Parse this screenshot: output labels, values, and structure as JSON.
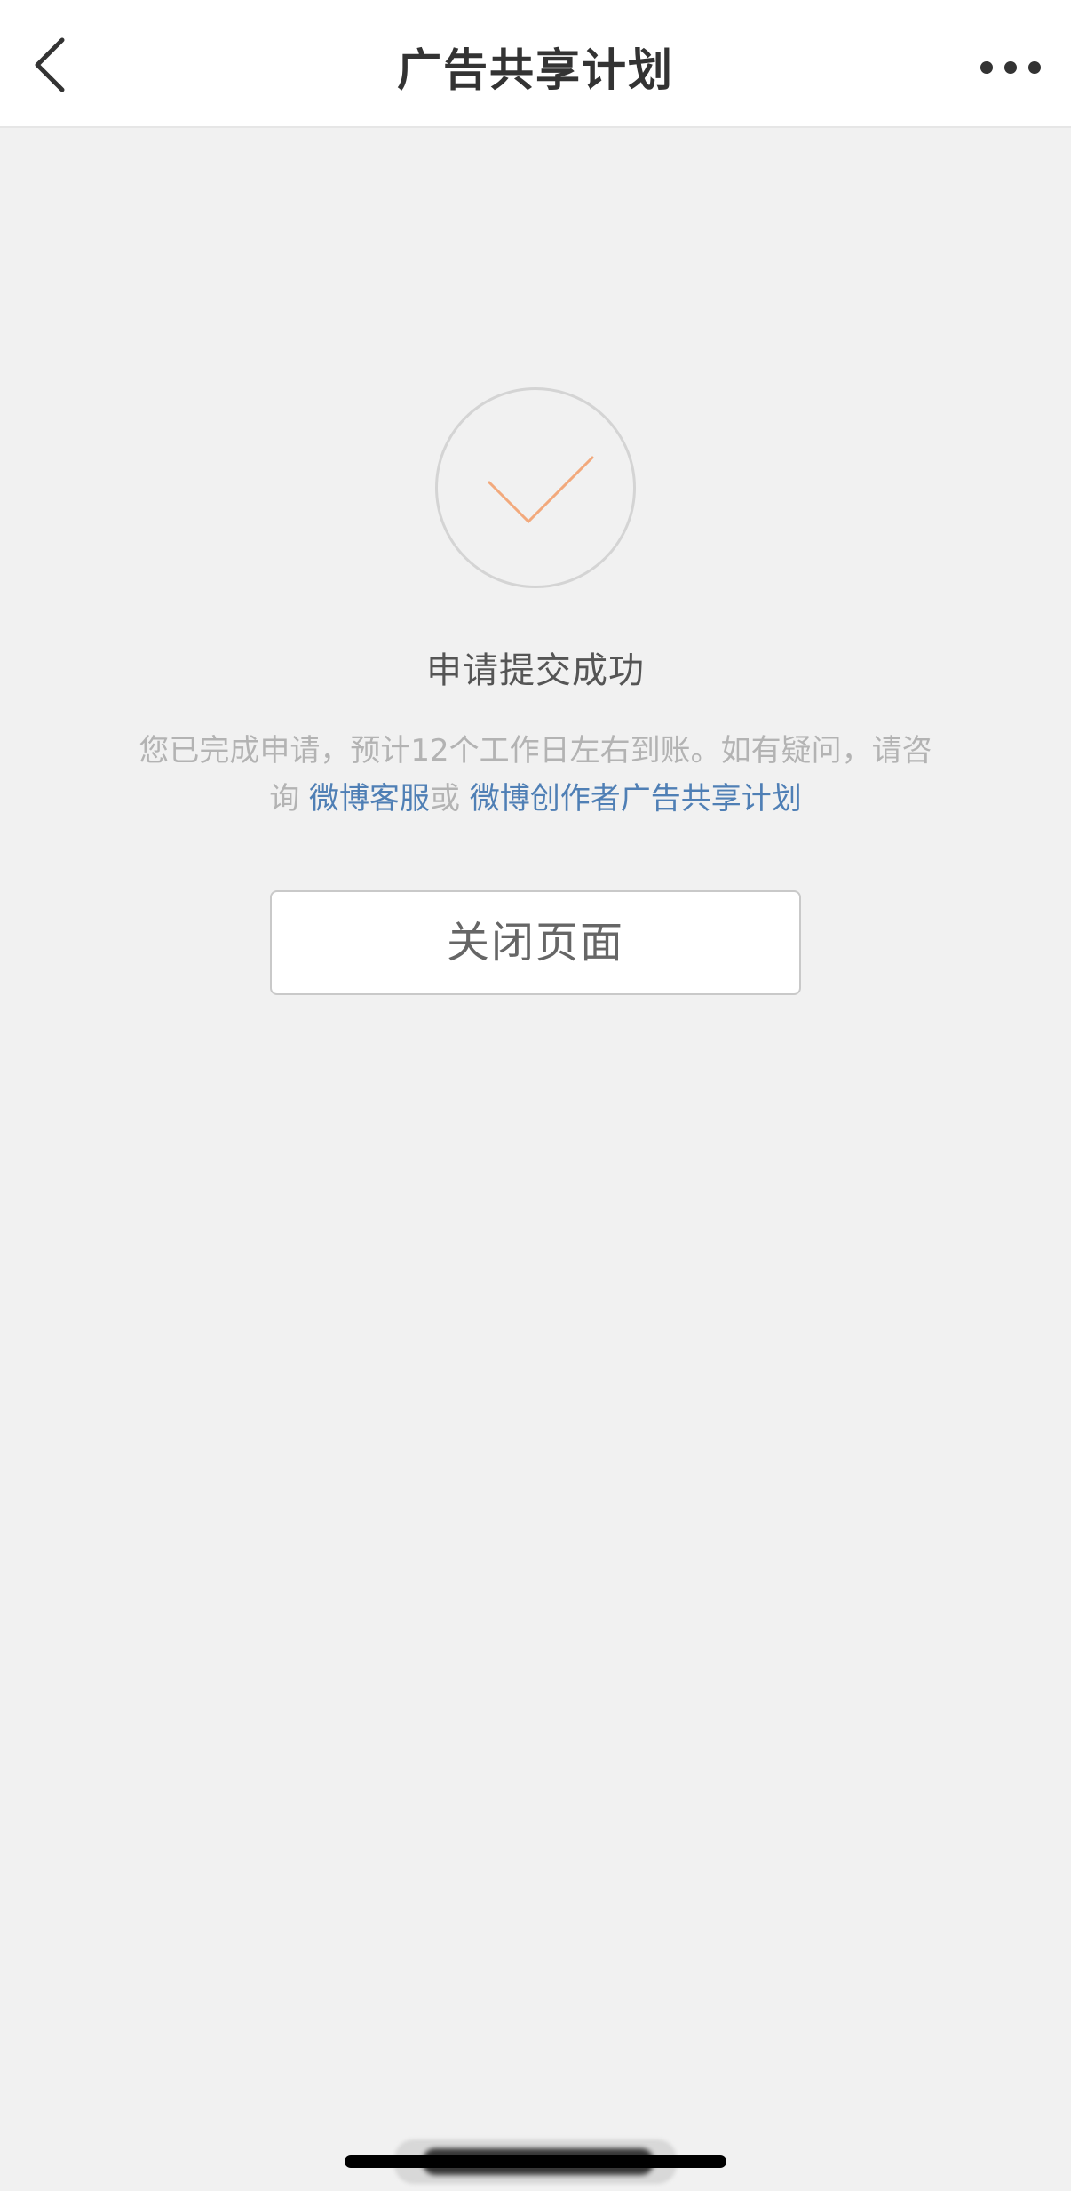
{
  "nav": {
    "title": "广告共享计划",
    "back_icon": "chevron-left-icon",
    "more_icon": "more-horizontal-icon"
  },
  "success": {
    "icon": "check-icon",
    "icon_color": "#f2a97c",
    "title": "申请提交成功"
  },
  "message": {
    "text_before": "您已完成申请，预计12个工作日左右到账。如有疑问，请咨询 ",
    "link_service": "微博客服",
    "text_or": "或",
    "link_plan": "微博创作者广告共享计划"
  },
  "close_button": {
    "label": "关闭页面"
  },
  "colors": {
    "background": "#f1f1f1",
    "link": "#4f7fb5",
    "muted_text": "#b3b3b3"
  }
}
